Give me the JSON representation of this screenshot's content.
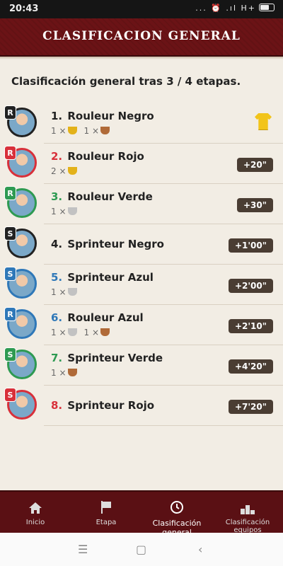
{
  "status": {
    "time": "20:43",
    "icons": "... ⏰ .ıl H+"
  },
  "header": {
    "title": "Clasificacion general"
  },
  "subtitle": "Clasificación general tras 3 / 4 etapas.",
  "rows": [
    {
      "pos": "1.",
      "name": "Rouleur Negro",
      "badge": "R",
      "badge_color": "#222222",
      "ring_color": "#222222",
      "pos_color": "#222222",
      "trophy1_count": "1 ×",
      "trophy1_type": "gold",
      "trophy2_count": "1 ×",
      "trophy2_type": "bronze",
      "gap": "",
      "leader": true
    },
    {
      "pos": "2.",
      "name": "Rouleur Rojo",
      "badge": "R",
      "badge_color": "#d8303a",
      "ring_color": "#d8303a",
      "pos_color": "#d8303a",
      "trophy1_count": "2 ×",
      "trophy1_type": "gold",
      "trophy2_count": "",
      "trophy2_type": "",
      "gap": "+20\"",
      "leader": false
    },
    {
      "pos": "3.",
      "name": "Rouleur Verde",
      "badge": "R",
      "badge_color": "#2e9a52",
      "ring_color": "#2e9a52",
      "pos_color": "#2e9a52",
      "trophy1_count": "1 ×",
      "trophy1_type": "silver",
      "trophy2_count": "",
      "trophy2_type": "",
      "gap": "+30\"",
      "leader": false
    },
    {
      "pos": "4.",
      "name": "Sprinteur Negro",
      "badge": "S",
      "badge_color": "#222222",
      "ring_color": "#222222",
      "pos_color": "#222222",
      "trophy1_count": "",
      "trophy1_type": "",
      "trophy2_count": "",
      "trophy2_type": "",
      "gap": "+1'00\"",
      "leader": false
    },
    {
      "pos": "5.",
      "name": "Sprinteur Azul",
      "badge": "S",
      "badge_color": "#2f78b8",
      "ring_color": "#2f78b8",
      "pos_color": "#2f78b8",
      "trophy1_count": "1 ×",
      "trophy1_type": "silver",
      "trophy2_count": "",
      "trophy2_type": "",
      "gap": "+2'00\"",
      "leader": false
    },
    {
      "pos": "6.",
      "name": "Rouleur Azul",
      "badge": "R",
      "badge_color": "#2f78b8",
      "ring_color": "#2f78b8",
      "pos_color": "#2f78b8",
      "trophy1_count": "1 ×",
      "trophy1_type": "silver",
      "trophy2_count": "1 ×",
      "trophy2_type": "bronze",
      "gap": "+2'10\"",
      "leader": false
    },
    {
      "pos": "7.",
      "name": "Sprinteur Verde",
      "badge": "S",
      "badge_color": "#2e9a52",
      "ring_color": "#2e9a52",
      "pos_color": "#2e9a52",
      "trophy1_count": "1 ×",
      "trophy1_type": "bronze",
      "trophy2_count": "",
      "trophy2_type": "",
      "gap": "+4'20\"",
      "leader": false
    },
    {
      "pos": "8.",
      "name": "Sprinteur Rojo",
      "badge": "S",
      "badge_color": "#d8303a",
      "ring_color": "#d8303a",
      "pos_color": "#d8303a",
      "trophy1_count": "",
      "trophy1_type": "",
      "trophy2_count": "",
      "trophy2_type": "",
      "gap": "+7'20\"",
      "leader": false
    }
  ],
  "nav": [
    {
      "label": "Inicio",
      "icon": "home-icon",
      "active": false
    },
    {
      "label": "Etapa",
      "icon": "flag-icon",
      "active": false
    },
    {
      "label": "Clasificación general",
      "icon": "clock-icon",
      "active": true
    },
    {
      "label": "Clasificación equipos",
      "icon": "podium-icon",
      "active": false
    }
  ],
  "sysbar": {
    "menu": "☰",
    "home": "▢",
    "back": "‹"
  }
}
